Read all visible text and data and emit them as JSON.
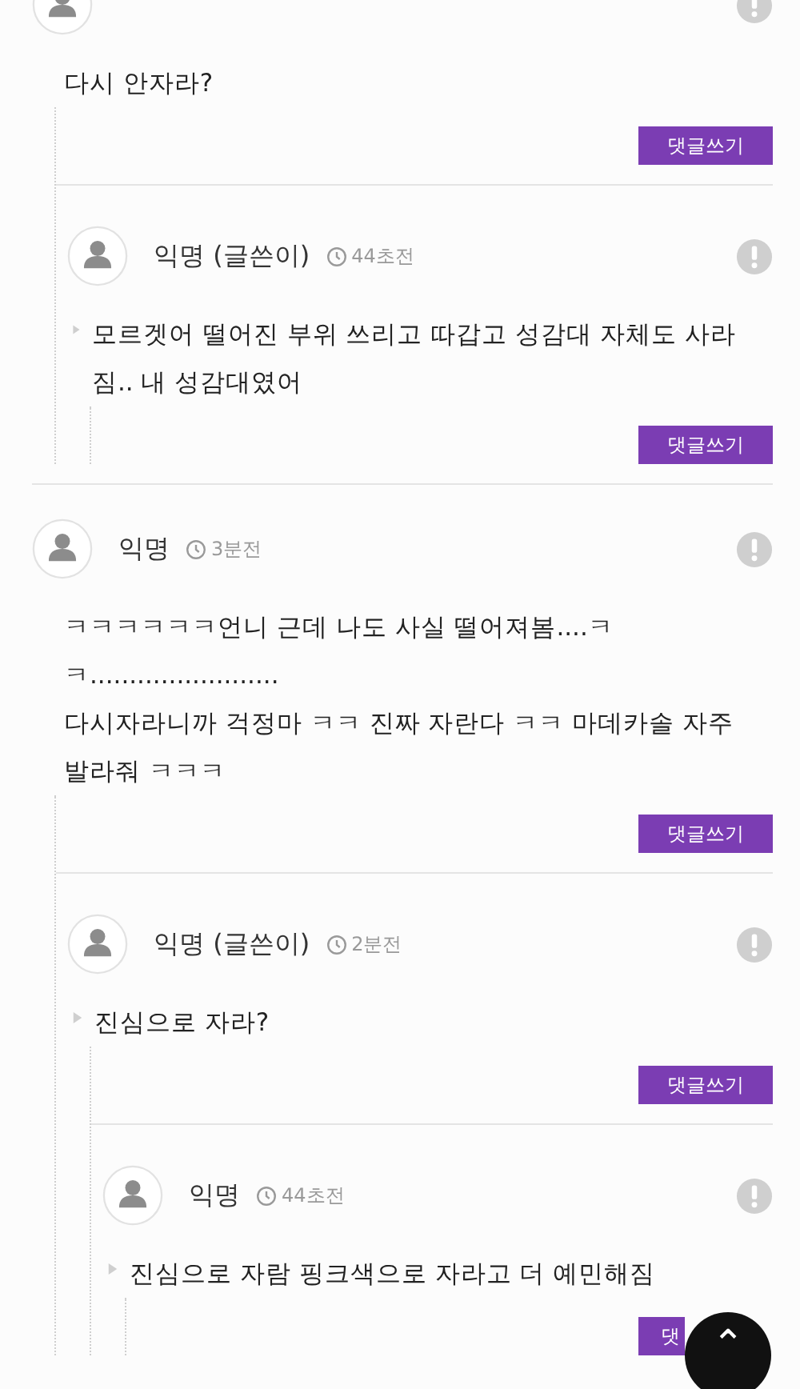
{
  "comments": [
    {
      "text": "다시 안자라?",
      "reply_button": "댓글쓰기",
      "children": [
        {
          "author": "익명 (글쓴이)",
          "time": "44초전",
          "text": "모르겟어 떨어진 부위 쓰리고 따갑고 성감대 자체도 사라짐.. 내 성감대였어",
          "reply_button": "댓글쓰기"
        }
      ]
    },
    {
      "author": "익명",
      "time": "3분전",
      "text": "ㅋㅋㅋㅋㅋㅋ언니 근데 나도 사실 떨어져봄....ㅋㅋ........................\n다시자라니까 걱정마 ㅋㅋ 진짜 자란다 ㅋㅋ 마데카솔 자주발라줘 ㅋㅋㅋ",
      "reply_button": "댓글쓰기",
      "children": [
        {
          "author": "익명 (글쓴이)",
          "time": "2분전",
          "text": "진심으로 자라?",
          "reply_button": "댓글쓰기",
          "children": [
            {
              "author": "익명",
              "time": "44초전",
              "text": "진심으로 자람 핑크색으로 자라고 더 예민해짐",
              "reply_button": "댓"
            }
          ]
        }
      ]
    }
  ],
  "scroll_top": {
    "symbol": "⌃"
  }
}
